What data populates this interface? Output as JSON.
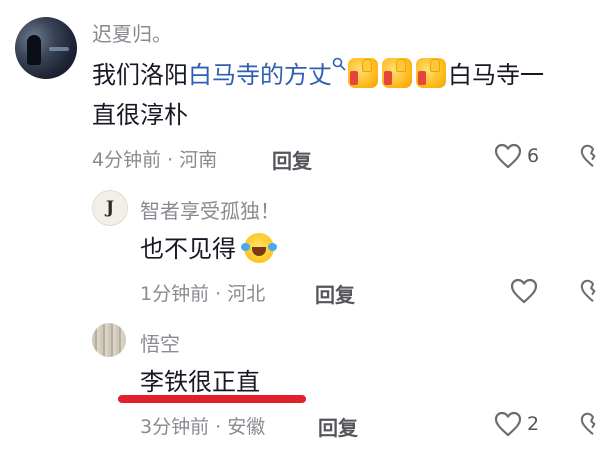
{
  "comment": {
    "username": "迟夏归。",
    "text_prefix": "我们洛阳",
    "link_text": "白马寺的方丈",
    "text_after_thumbs_line1": "白马寺一",
    "text_line2": "直很淳朴",
    "time": "4分钟前",
    "location": "河南",
    "reply_label": "回复",
    "like_count": "6"
  },
  "replies": [
    {
      "username": "智者享受孤独！",
      "avatar_letter": "J",
      "text": "也不见得",
      "time": "1分钟前",
      "location": "河北",
      "reply_label": "回复",
      "like_count": ""
    },
    {
      "username": "悟空",
      "text": "李铁很正直",
      "time": "3分钟前",
      "location": "安徽",
      "reply_label": "回复",
      "like_count": "2"
    }
  ],
  "meta_separator": " · ",
  "icons": {
    "like": "heart-outline-icon",
    "dislike": "broken-heart-icon",
    "search_badge": "search-icon",
    "thumbs": "thumbs-up-emoji",
    "cry": "crying-laughing-emoji"
  },
  "colors": {
    "link": "#2f5fb3",
    "meta": "#8a8b91",
    "underline": "#e0202a"
  }
}
